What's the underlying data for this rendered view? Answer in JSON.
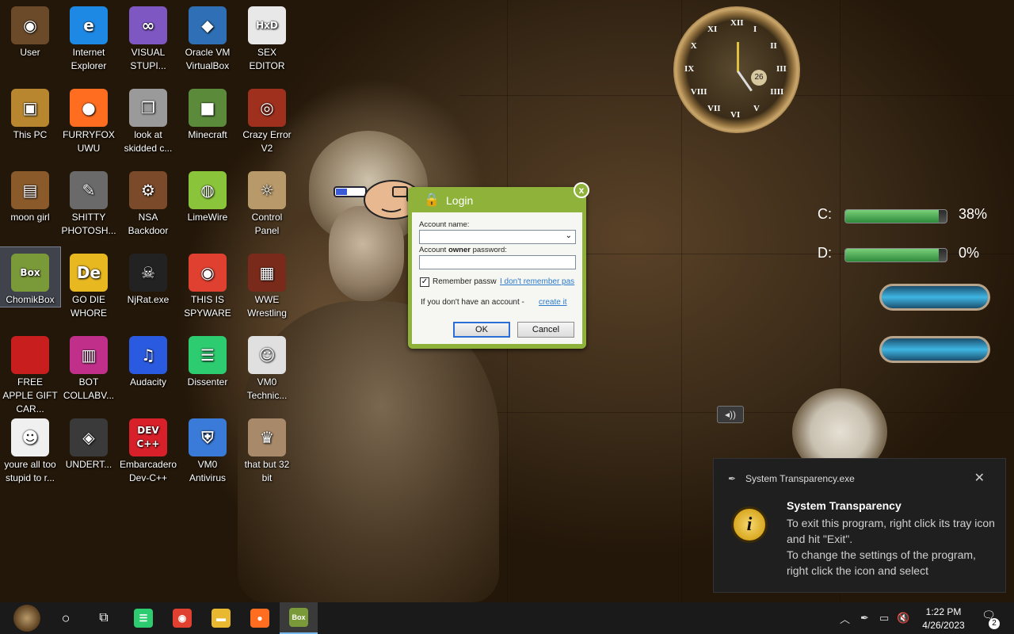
{
  "desktop": {
    "icons": [
      {
        "label": "User",
        "glyph": "◉",
        "color": "#6b4a2a"
      },
      {
        "label": "Internet Explorer",
        "glyph": "e",
        "color": "#1e88e5"
      },
      {
        "label": "VISUAL STUPI...",
        "glyph": "∞",
        "color": "#7e57c2"
      },
      {
        "label": "Oracle VM VirtualBox",
        "glyph": "◆",
        "color": "#2f6fb5"
      },
      {
        "label": "SEX EDITOR",
        "glyph": "HxD",
        "color": "#e8e8e8"
      },
      {
        "label": "This PC",
        "glyph": "▣",
        "color": "#b8862e"
      },
      {
        "label": "FURRYFOX UWU",
        "glyph": "●",
        "color": "#ff6d21"
      },
      {
        "label": "look at skidded c...",
        "glyph": "❐",
        "color": "#9a9a9a"
      },
      {
        "label": "Minecraft",
        "glyph": "■",
        "color": "#5a8a3a"
      },
      {
        "label": "Crazy Error V2",
        "glyph": "◎",
        "color": "#a0301e"
      },
      {
        "label": "moon girl",
        "glyph": "▤",
        "color": "#8a5a2a"
      },
      {
        "label": "SHITTY PHOTOSH...",
        "glyph": "✎",
        "color": "#6a6a6a"
      },
      {
        "label": "NSA Backdoor",
        "glyph": "⚙",
        "color": "#7a4a2a"
      },
      {
        "label": "LimeWire",
        "glyph": "◍",
        "color": "#8ac43a"
      },
      {
        "label": "Control Panel",
        "glyph": "☼",
        "color": "#b89a6a"
      },
      {
        "label": "ChomikBox",
        "glyph": "Box",
        "color": "#7a9a3a"
      },
      {
        "label": "GO DIE WHORE",
        "glyph": "De",
        "color": "#e8b820"
      },
      {
        "label": "NjRat.exe",
        "glyph": "☠",
        "color": "#222222"
      },
      {
        "label": "THIS IS SPYWARE",
        "glyph": "◉",
        "color": "#e04030"
      },
      {
        "label": "WWE Wrestling",
        "glyph": "▦",
        "color": "#7a2a1a"
      },
      {
        "label": "FREE APPLE GIFT CAR...",
        "glyph": "",
        "color": "#c81e1e"
      },
      {
        "label": "BOT COLLABV...",
        "glyph": "▥",
        "color": "#c0308a"
      },
      {
        "label": "Audacity",
        "glyph": "♫",
        "color": "#2a5ae0"
      },
      {
        "label": "Dissenter",
        "glyph": "☰",
        "color": "#2ecc71"
      },
      {
        "label": "VM0 Technic...",
        "glyph": "☺",
        "color": "#e0e0e0"
      },
      {
        "label": "youre all too stupid to r...",
        "glyph": "☻",
        "color": "#f0f0f0"
      },
      {
        "label": "UNDERT...",
        "glyph": "◈",
        "color": "#3a3a3a"
      },
      {
        "label": "Embarcadero Dev-C++",
        "glyph": "DEV C++",
        "color": "#d8202a"
      },
      {
        "label": "VM0 Antivirus",
        "glyph": "⛨",
        "color": "#3a7ad8"
      },
      {
        "label": "that but 32 bit",
        "glyph": "♛",
        "color": "#a88a6a"
      }
    ]
  },
  "widgets": {
    "clock": {
      "date": "26",
      "numerals": [
        "XII",
        "I",
        "II",
        "III",
        "IIII",
        "V",
        "VI",
        "VII",
        "VIII",
        "IX",
        "X",
        "XI"
      ]
    },
    "drives": [
      {
        "label": "C:",
        "percent": "38%",
        "fill": 0.38
      },
      {
        "label": "D:",
        "percent": "0%",
        "fill": 0.0
      }
    ]
  },
  "login_dialog": {
    "title": "Login",
    "close_label": "x",
    "account_name_label": "Account name:",
    "account_name_value": "",
    "password_label_pre": "Account ",
    "password_label_bold": "owner",
    "password_label_post": " password:",
    "password_value": "",
    "remember_checked": true,
    "remember_label": "Remember passw",
    "forgot_link": "I don't remember pas",
    "no_account_text": "If you don't have an account - ",
    "create_link": "create it",
    "ok_label": "OK",
    "cancel_label": "Cancel"
  },
  "notification": {
    "app_name": "System Transparency.exe",
    "close_label": "✕",
    "icon_glyph": "i",
    "title": "System Transparency",
    "line1": "To exit this program, right click its tray icon and hit \"Exit\".",
    "line2": "To change the settings of the program, right click the icon and select"
  },
  "taskbar": {
    "search_glyph": "○",
    "task_view_glyph": "⧉",
    "items": [
      {
        "name": "dissenter",
        "glyph": "☰",
        "color": "#2ecc71"
      },
      {
        "name": "chrome",
        "glyph": "◉",
        "color": "#e04030"
      },
      {
        "name": "file-explorer",
        "glyph": "▬",
        "color": "#e8b830"
      },
      {
        "name": "firefox",
        "glyph": "●",
        "color": "#ff6d21"
      },
      {
        "name": "chomikbox",
        "glyph": "Box",
        "color": "#7a9a3a"
      }
    ],
    "tray_chevron": "︿",
    "time": "1:22 PM",
    "date": "4/26/2023",
    "notif_count": "2"
  }
}
